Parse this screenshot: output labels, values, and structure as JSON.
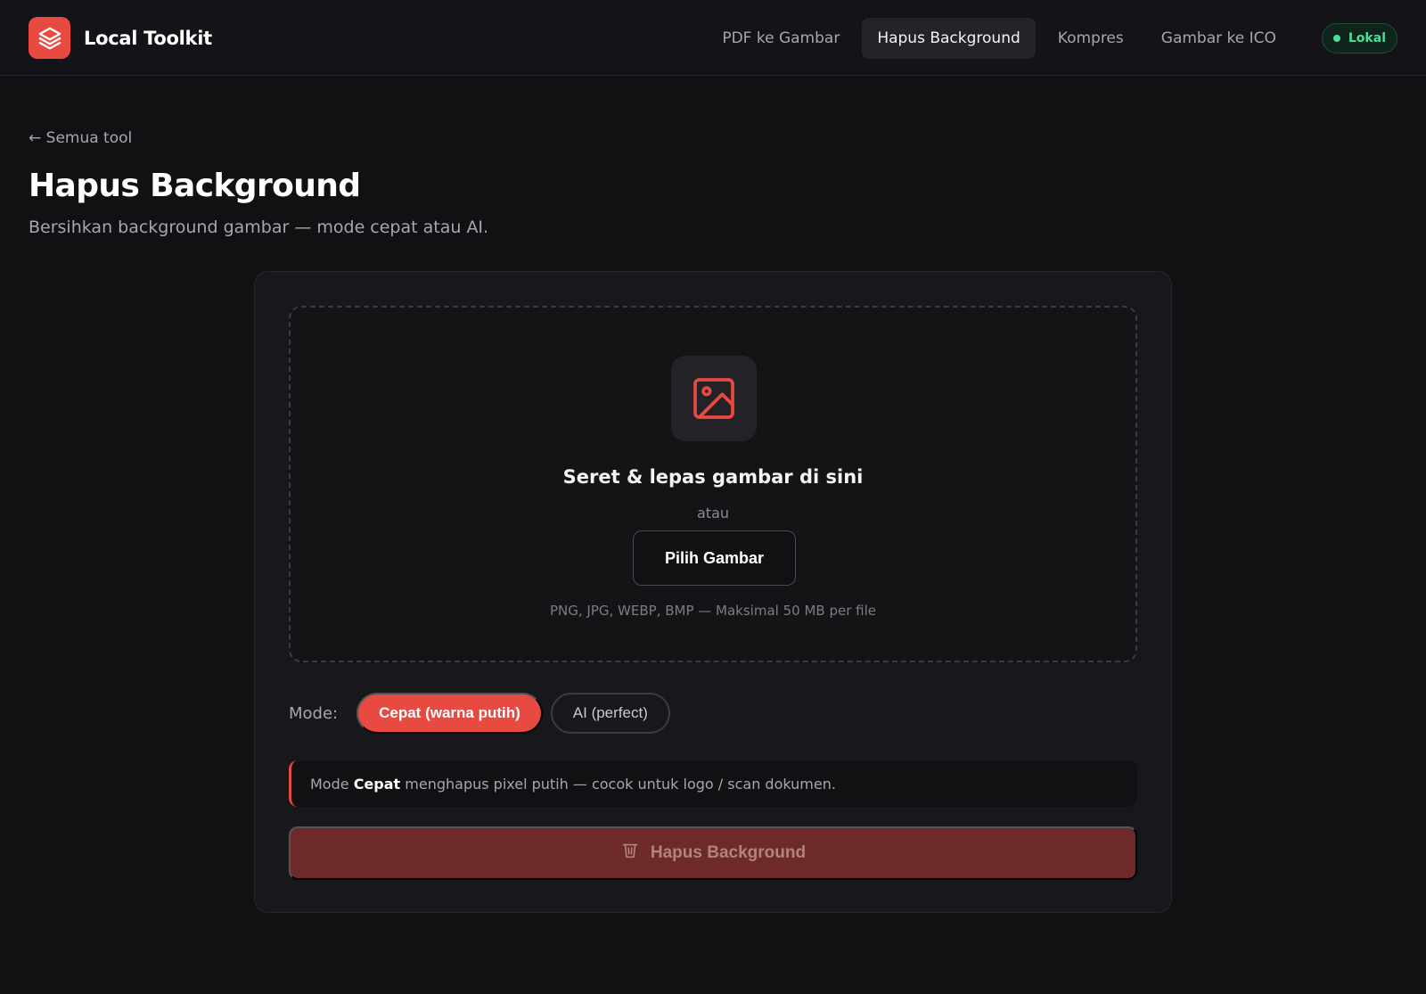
{
  "app": {
    "name": "Local Toolkit",
    "logo_icon": "layers-icon",
    "accent_color": "#e84a42"
  },
  "nav": {
    "items": [
      {
        "label": "PDF ke Gambar",
        "active": false
      },
      {
        "label": "Hapus Background",
        "active": true
      },
      {
        "label": "Kompres",
        "active": false
      },
      {
        "label": "Gambar ke ICO",
        "active": false
      }
    ],
    "status": {
      "label": "Lokal",
      "color": "#4ade9a"
    }
  },
  "page": {
    "back_link": "← Semua tool",
    "title": "Hapus Background",
    "subtitle": "Bersihkan background gambar — mode cepat atau AI."
  },
  "dropzone": {
    "icon": "image-icon",
    "title": "Seret & lepas gambar di sini",
    "or_text": "atau",
    "button_label": "Pilih Gambar",
    "hint": "PNG, JPG, WEBP, BMP — Maksimal 50 MB per file"
  },
  "mode": {
    "label": "Mode:",
    "options": [
      {
        "label": "Cepat (warna putih)",
        "selected": true
      },
      {
        "label": "AI (perfect)",
        "selected": false
      }
    ]
  },
  "info": {
    "prefix": "Mode",
    "highlight": "Cepat",
    "rest": "menghapus pixel putih — cocok untuk logo / scan dokumen."
  },
  "action": {
    "icon": "trash-icon",
    "label": "Hapus Background",
    "disabled": true
  }
}
